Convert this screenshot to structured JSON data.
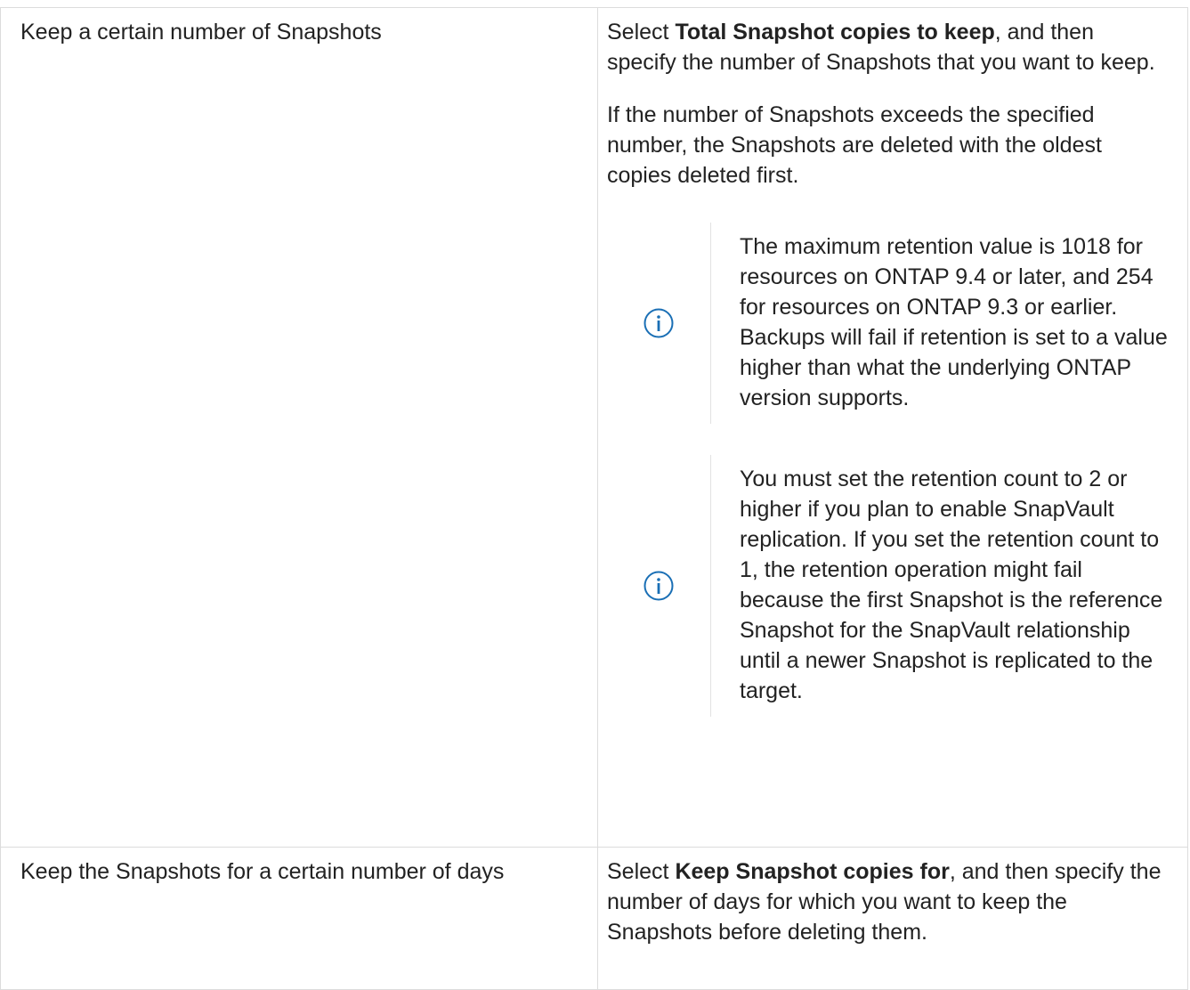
{
  "rows": [
    {
      "left": "Keep a certain number of Snapshots",
      "right": {
        "p1_pre": "Select ",
        "p1_bold": "Total Snapshot copies to keep",
        "p1_post": ", and then specify the number of Snapshots that you want to keep.",
        "p2": "If the number of Snapshots exceeds the specified number, the Snapshots are deleted with the oldest copies deleted first.",
        "notes": [
          {
            "icon": "info-icon",
            "text": "The maximum retention value is 1018 for resources on ONTAP 9.4 or later, and 254 for resources on ONTAP 9.3 or earlier. Backups will fail if retention is set to a value higher than what the underlying ONTAP version supports."
          },
          {
            "icon": "info-icon",
            "text": "You must set the retention count to 2 or higher if you plan to enable SnapVault replication. If you set the retention count to 1, the retention operation might fail because the first Snapshot is the reference Snapshot for the SnapVault relationship until a newer Snapshot is replicated to the target."
          }
        ]
      }
    },
    {
      "left": "Keep the Snapshots for a certain number of days",
      "right": {
        "p1_pre": "Select ",
        "p1_bold": "Keep Snapshot copies for",
        "p1_post": ", and then specify the number of days for which you want to keep the Snapshots before deleting them."
      }
    }
  ],
  "colors": {
    "icon": "#1a6fb5",
    "text": "#222222",
    "border": "#dcdcdc"
  }
}
